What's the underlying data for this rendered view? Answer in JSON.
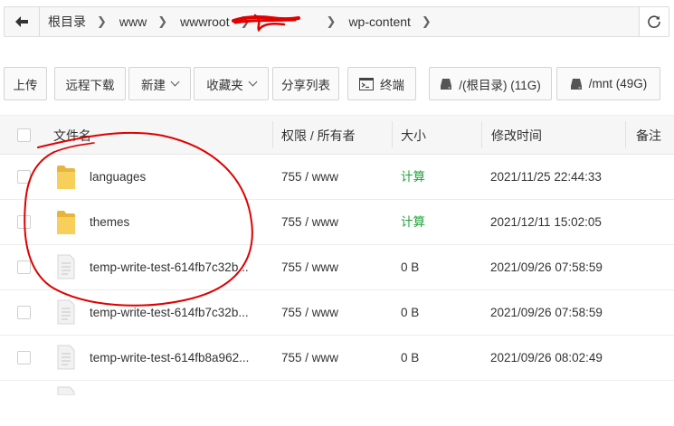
{
  "breadcrumb": {
    "items": [
      "根目录",
      "www",
      "wwwroot",
      "wp-content"
    ],
    "back_icon": "arrow-left-icon",
    "refresh_icon": "refresh-icon"
  },
  "toolbar": {
    "upload": "上传",
    "remote_download": "远程下载",
    "new": "新建",
    "favorites": "收藏夹",
    "share_list": "分享列表",
    "terminal": "终端",
    "disk_root": "/(根目录) (11G)",
    "disk_mnt": "/mnt (49G)"
  },
  "table": {
    "headers": {
      "name": "文件名",
      "perm": "权限 / 所有者",
      "size": "大小",
      "mtime": "修改时间",
      "note": "备注"
    },
    "rows": [
      {
        "type": "folder",
        "name": "languages",
        "perm": "755 / www",
        "size": "计算",
        "mtime": "2021/11/25 22:44:33"
      },
      {
        "type": "folder",
        "name": "themes",
        "perm": "755 / www",
        "size": "计算",
        "mtime": "2021/12/11 15:02:05"
      },
      {
        "type": "file",
        "name": "temp-write-test-614fb7c32b...",
        "perm": "755 / www",
        "size": "0 B",
        "mtime": "2021/09/26 07:58:59"
      },
      {
        "type": "file",
        "name": "temp-write-test-614fb7c32b...",
        "perm": "755 / www",
        "size": "0 B",
        "mtime": "2021/09/26 07:58:59"
      },
      {
        "type": "file",
        "name": "temp-write-test-614fb8a962...",
        "perm": "755 / www",
        "size": "0 B",
        "mtime": "2021/09/26 08:02:49"
      }
    ]
  },
  "colors": {
    "accent_green": "#20a53a",
    "folder_yellow": "#f5c94f",
    "annotation_red": "#e00000"
  }
}
